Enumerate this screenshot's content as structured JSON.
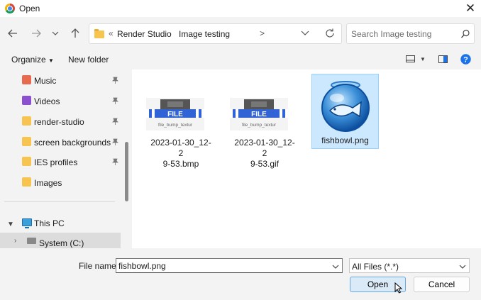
{
  "window": {
    "title": "Open"
  },
  "address": {
    "collapse_marker": "«",
    "crumbs": [
      "Render Studio",
      "Image testing"
    ],
    "separator": ">"
  },
  "search": {
    "placeholder": "Search Image testing"
  },
  "toolbar": {
    "organize_label": "Organize",
    "new_folder_label": "New folder",
    "help_label": "?"
  },
  "sidebar": {
    "items": [
      {
        "label": "Music",
        "icon": "music-folder-icon",
        "pinned": true
      },
      {
        "label": "Videos",
        "icon": "videos-folder-icon",
        "pinned": true
      },
      {
        "label": "render-studio",
        "icon": "folder-icon",
        "pinned": true
      },
      {
        "label": "screen backgrounds",
        "icon": "folder-icon",
        "pinned": true
      },
      {
        "label": "IES profiles",
        "icon": "folder-icon",
        "pinned": true
      },
      {
        "label": "Images",
        "icon": "folder-icon",
        "pinned": false
      }
    ],
    "this_pc_label": "This PC",
    "system_drive_label": "System (C:)"
  },
  "files": [
    {
      "name": "2023-01-30_12-29-53.bmp",
      "name_lines": [
        "2023-01-30_12-2",
        "9-53.bmp"
      ],
      "thumb_text": "FILE",
      "thumb_caption": "file_bump_textur",
      "selected": false
    },
    {
      "name": "2023-01-30_12-29-53.gif",
      "name_lines": [
        "2023-01-30_12-2",
        "9-53.gif"
      ],
      "thumb_text": "FILE",
      "thumb_caption": "file_bump_textur",
      "selected": false
    },
    {
      "name": "fishbowl.png",
      "name_lines": [
        "fishbowl.png"
      ],
      "selected": true
    }
  ],
  "bottom": {
    "file_name_label": "File name:",
    "file_name_value": "fishbowl.png",
    "file_type_value": "All Files (*.*)",
    "open_label": "Open",
    "cancel_label": "Cancel"
  },
  "colors": {
    "selection": "#cce8ff",
    "accent": "#0067c0",
    "help": "#1a73e8"
  }
}
